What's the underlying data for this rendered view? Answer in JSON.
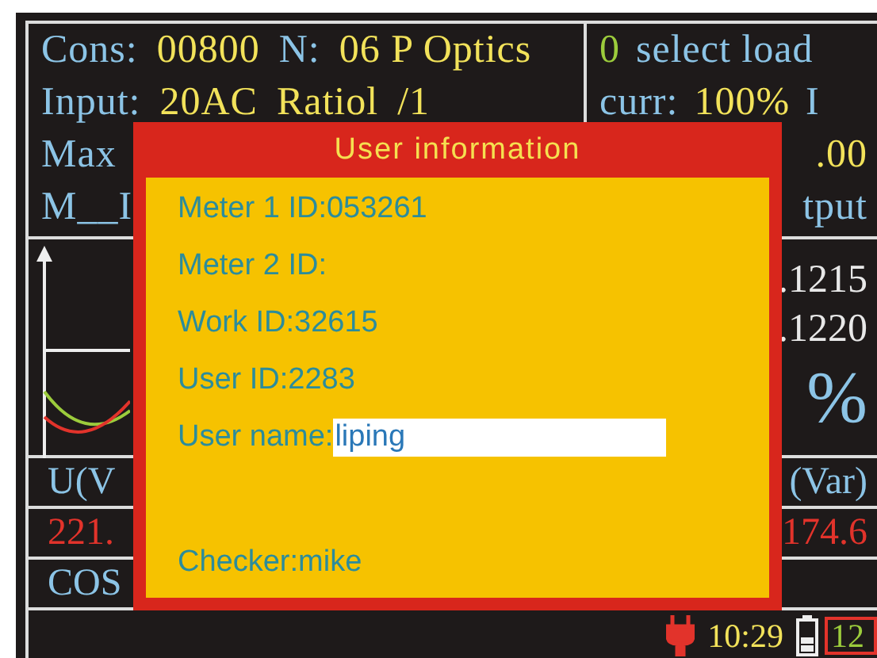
{
  "header": {
    "rows": [
      {
        "left": [
          {
            "kind": "label",
            "text": "Cons:"
          },
          {
            "kind": "value",
            "text": "00800"
          },
          {
            "kind": "label",
            "text": "N:"
          },
          {
            "kind": "value",
            "text": "06 P Optics"
          }
        ],
        "right": [
          {
            "kind": "state",
            "text": "0"
          },
          {
            "kind": "label",
            "text": "select load"
          }
        ]
      },
      {
        "left": [
          {
            "kind": "label",
            "text": "Input:"
          },
          {
            "kind": "value",
            "text": "20AC"
          },
          {
            "kind": "value",
            "text": "Ratiol"
          },
          {
            "kind": "value",
            "text": "/1"
          }
        ],
        "right": [
          {
            "kind": "label",
            "text": "curr:"
          },
          {
            "kind": "value",
            "text": "100%"
          },
          {
            "kind": "label",
            "text": "I"
          }
        ]
      },
      {
        "left": [
          {
            "kind": "label",
            "text": "Max"
          }
        ],
        "right": [
          {
            "kind": "value",
            "text": ".00"
          }
        ]
      },
      {
        "left": [
          {
            "kind": "label",
            "text": "M__I"
          }
        ],
        "right": [
          {
            "kind": "label",
            "text": "tput"
          }
        ]
      }
    ]
  },
  "readings": [
    [
      {
        "kind": "plain",
        "text": ".1215"
      }
    ],
    [
      {
        "kind": "plain",
        "text": ".1220"
      }
    ],
    [
      {
        "kind": "label",
        "text": "%"
      }
    ]
  ],
  "table": [
    {
      "left": {
        "kind": "label",
        "text": "U(V"
      },
      "right": {
        "kind": "label",
        "text": "(Var)"
      }
    },
    {
      "left": {
        "kind": "reading",
        "text": "221."
      },
      "right": {
        "kind": "reading",
        "text": "174.6"
      }
    },
    {
      "left": {
        "kind": "label",
        "text": "COS"
      }
    }
  ],
  "status_bar": {
    "time": "10:29",
    "count": "12"
  },
  "dialog": {
    "title": "User information",
    "fields": [
      {
        "kind": "text",
        "text": "Meter 1 ID:053261"
      },
      {
        "kind": "text",
        "text": "Meter 2 ID:"
      },
      {
        "kind": "text",
        "text": "Work ID:32615"
      },
      {
        "kind": "text",
        "text": "User ID:2283"
      },
      {
        "kind": "input",
        "label": "User name:",
        "value": "liping"
      },
      {
        "kind": "text",
        "text": "Checker:mike"
      }
    ]
  }
}
